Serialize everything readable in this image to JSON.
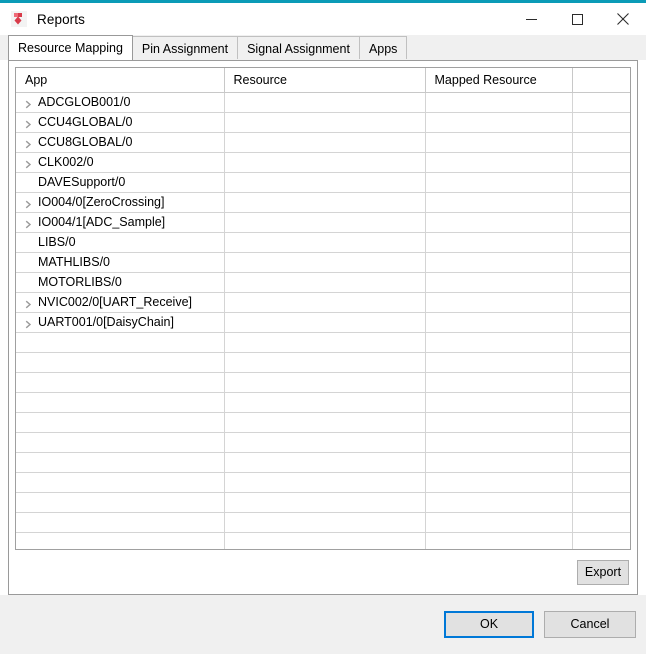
{
  "window": {
    "title": "Reports",
    "icon": "dave-app-icon",
    "accent_color": "#0b9bb7",
    "controls": [
      {
        "name": "minimize",
        "glyph": "minimize-icon"
      },
      {
        "name": "maximize",
        "glyph": "maximize-icon"
      },
      {
        "name": "close",
        "glyph": "close-icon"
      }
    ]
  },
  "tabs": [
    {
      "label": "Resource Mapping",
      "active": true
    },
    {
      "label": "Pin Assignment",
      "active": false
    },
    {
      "label": "Signal Assignment",
      "active": false
    },
    {
      "label": "Apps",
      "active": false
    }
  ],
  "table": {
    "columns": [
      "App",
      "Resource",
      "Mapped Resource",
      ""
    ],
    "rows": [
      {
        "expandable": true,
        "app": "ADCGLOB001/0",
        "resource": "",
        "mapped_resource": "",
        "extra": ""
      },
      {
        "expandable": true,
        "app": "CCU4GLOBAL/0",
        "resource": "",
        "mapped_resource": "",
        "extra": ""
      },
      {
        "expandable": true,
        "app": "CCU8GLOBAL/0",
        "resource": "",
        "mapped_resource": "",
        "extra": ""
      },
      {
        "expandable": true,
        "app": "CLK002/0",
        "resource": "",
        "mapped_resource": "",
        "extra": ""
      },
      {
        "expandable": false,
        "app": "DAVESupport/0",
        "resource": "",
        "mapped_resource": "",
        "extra": ""
      },
      {
        "expandable": true,
        "app": "IO004/0[ZeroCrossing]",
        "resource": "",
        "mapped_resource": "",
        "extra": ""
      },
      {
        "expandable": true,
        "app": "IO004/1[ADC_Sample]",
        "resource": "",
        "mapped_resource": "",
        "extra": ""
      },
      {
        "expandable": false,
        "app": "LIBS/0",
        "resource": "",
        "mapped_resource": "",
        "extra": ""
      },
      {
        "expandable": false,
        "app": "MATHLIBS/0",
        "resource": "",
        "mapped_resource": "",
        "extra": ""
      },
      {
        "expandable": false,
        "app": "MOTORLIBS/0",
        "resource": "",
        "mapped_resource": "",
        "extra": ""
      },
      {
        "expandable": true,
        "app": "NVIC002/0[UART_Receive]",
        "resource": "",
        "mapped_resource": "",
        "extra": ""
      },
      {
        "expandable": true,
        "app": "UART001/0[DaisyChain]",
        "resource": "",
        "mapped_resource": "",
        "extra": ""
      }
    ],
    "empty_row_count": 11
  },
  "buttons": {
    "export": "Export",
    "ok": "OK",
    "cancel": "Cancel",
    "ok_focus_color": "#0078d7"
  }
}
